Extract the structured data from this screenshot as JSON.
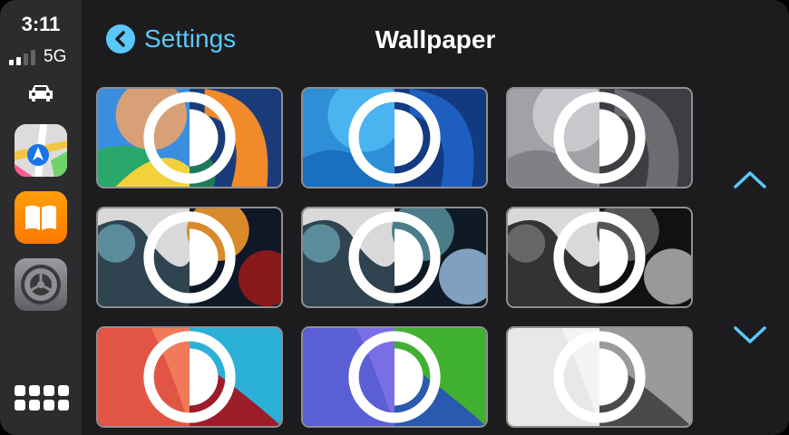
{
  "status": {
    "time": "3:11",
    "network": "5G"
  },
  "header": {
    "back_label": "Settings",
    "title": "Wallpaper"
  },
  "sidebar": {
    "apps": [
      {
        "name": "Maps"
      },
      {
        "name": "Books"
      },
      {
        "name": "Settings"
      }
    ]
  },
  "colors": {
    "accent": "#5ac8fa",
    "sidebar_bg": "#2c2c2e",
    "background": "#1c1c1e"
  },
  "wallpapers": [
    {
      "theme": "colorful",
      "light": "#f2a34a",
      "dark": "#1a3b7a"
    },
    {
      "theme": "blue",
      "light": "#2e8fd6",
      "dark": "#123a80"
    },
    {
      "theme": "gray",
      "light": "#a2a2a6",
      "dark": "#3e3e42"
    },
    {
      "theme": "orange-bloom",
      "light": "#d9d9d9",
      "dark": "#d85a2a"
    },
    {
      "theme": "teal-bloom",
      "light": "#d9d9d9",
      "dark": "#5a8fa0"
    },
    {
      "theme": "mono-bloom",
      "light": "#d9d9d9",
      "dark": "#555"
    },
    {
      "theme": "red",
      "light": "#e25545",
      "dark": "#9b1d2a"
    },
    {
      "theme": "indigo-green",
      "light": "#5a5fd6",
      "dark": "#40b030"
    },
    {
      "theme": "white",
      "light": "#e8e8e8",
      "dark": "#6a6a6a"
    }
  ]
}
